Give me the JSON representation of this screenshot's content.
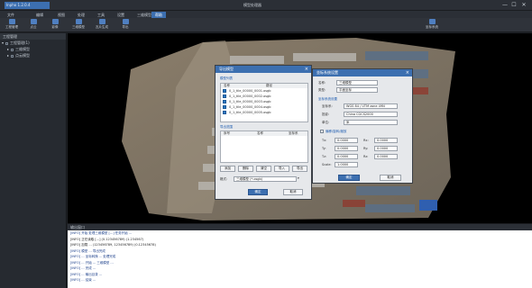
{
  "titlebar": {
    "app_title": "Inpho 1.2.0.4",
    "center_title": "模型处理器",
    "minimize": "—",
    "maximize": "☐",
    "close": "✕"
  },
  "menu": {
    "tabs": [
      "文件",
      "编辑",
      "视图",
      "处理",
      "工具",
      "设置",
      "三维模型",
      "帮助"
    ],
    "active_index": 6
  },
  "toolbar": {
    "tools": [
      "工程管理",
      "点云",
      "影像",
      "三维模型",
      "瓦片生成",
      "导出",
      "坐标系统"
    ],
    "right_tool": "坐标系统"
  },
  "left_panel": {
    "header": "工程管理",
    "tree": [
      "工程管理(1)",
      "三维模型",
      "点云模型"
    ]
  },
  "log_panel": {
    "header": "输出窗口",
    "lines": [
      "[INFO] 开始 处理三维模型 [...] 任务开始 ...",
      "[INFO] 正在读取 [...] (0.123456789) (1.234567)",
      "[INFO] 加载 ... (123456789, 123456789) (0.12345678)",
      "[INFO] 模型 ... 导出完成",
      "[INFO] ... 坐标转换 ... 处理完成",
      "[INFO] ... 开始 ... 三维模型 ...",
      "[INFO] ... 完成 ...",
      "[INFO] ... 输出目录 ...",
      "[INFO] ... 结束 ..."
    ]
  },
  "dialog_left": {
    "title": "导出模型",
    "section_top": "模型列表",
    "col_name": "名称",
    "col_path": "路径",
    "rows": [
      "0_1_tile_00000_0001.osgb",
      "0_1_tile_00000_0002.osgb",
      "0_1_tile_00000_0003.osgb",
      "0_1_tile_00000_0004.osgb",
      "0_1_tile_00000_0005.osgb"
    ],
    "section_bottom": "导出范围",
    "bottom_cols": [
      "序号",
      "名称",
      "坐标系"
    ],
    "buttons": [
      "添加",
      "删除",
      "清空",
      "导入",
      "导出"
    ],
    "format_label": "格式:",
    "format_value": "三维模型 (*.osgb)",
    "ok": "确定",
    "cancel": "取消"
  },
  "dialog_right": {
    "title": "坐标系统设置",
    "name_label": "名称:",
    "name_value": "三维模型",
    "type_label": "类型:",
    "type_value": "平面坐标",
    "section1": "坐标系统设置",
    "cs_label": "坐标系:",
    "cs_value": "WGS 84 / UTM zone 49N",
    "proj_label": "投影:",
    "proj_value": "China CGCS2000",
    "unit_label": "单位:",
    "unit_value": "米",
    "section2": "偏移/旋转/缩放",
    "tx_label": "Tx:",
    "tx_value": "0.0000",
    "ty_label": "Ty:",
    "ty_value": "0.0000",
    "tz_label": "Tz:",
    "tz_value": "0.0000",
    "rx_label": "Rx:",
    "rx_value": "0.0000",
    "ry_label": "Ry:",
    "ry_value": "0.0000",
    "rz_label": "Rz:",
    "rz_value": "0.0000",
    "scale_label": "Scale:",
    "scale_value": "1.0000",
    "ok": "确定",
    "cancel": "取消"
  },
  "colors": {
    "accent": "#3c6fb0",
    "window_bg": "#1e2126",
    "dialog_bg": "#e6e8eb"
  }
}
